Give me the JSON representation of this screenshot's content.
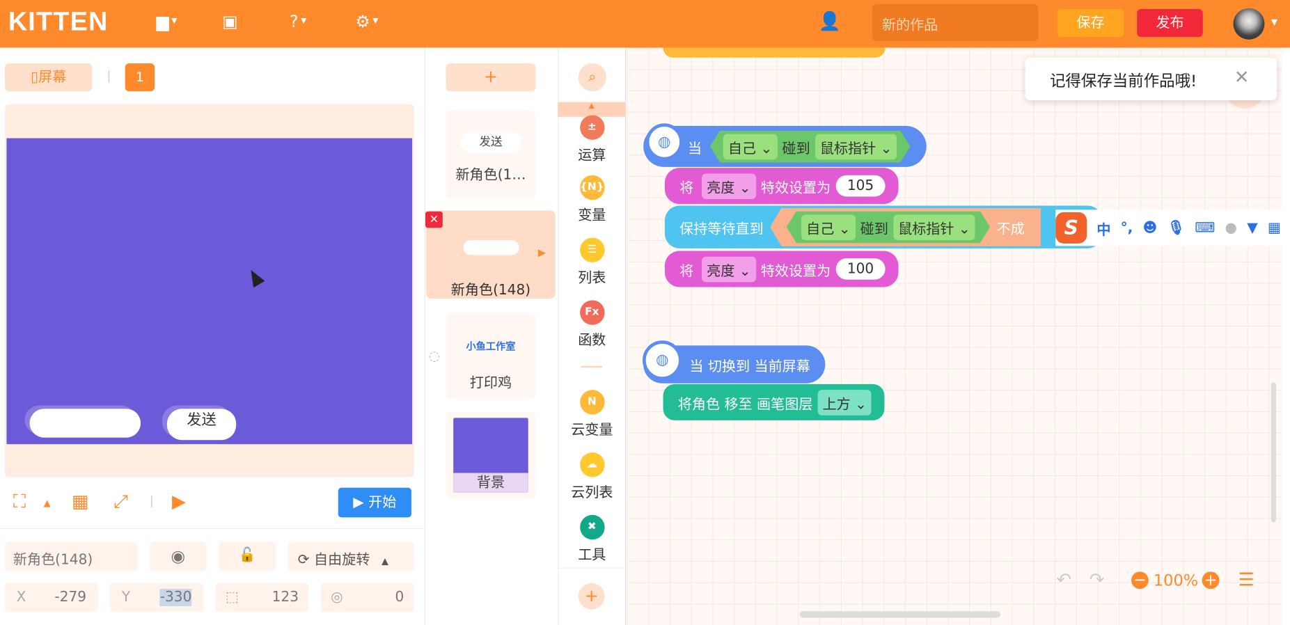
{
  "header": {
    "logo": "KITTEN",
    "project_placeholder": "新的作品",
    "save_label": "保存",
    "publish_label": "发布",
    "colors": {
      "bar": "#ff8a2b",
      "save": "#ffa51f",
      "publish": "#f2283a"
    },
    "icons": [
      "folder-icon",
      "backpack-icon",
      "help-icon",
      "settings-icon",
      "add-user-icon"
    ]
  },
  "stage": {
    "screen_label": "屏幕",
    "page_number": "1",
    "send_label": "发送",
    "start_label": "开始",
    "stage_color": "#6c5bd9"
  },
  "props": {
    "sprite_name": "新角色(148)",
    "rotation_label": "自由旋转",
    "x_label": "X",
    "x": "-279",
    "y_label": "Y",
    "y": "-330",
    "size": "123",
    "direction": "0"
  },
  "sprites": {
    "items": [
      {
        "name": "新角色(1…",
        "thumb_text": "发送"
      },
      {
        "name": "新角色(148)"
      },
      {
        "name": "打印鸡",
        "thumb_text": "小鱼工作室"
      },
      {
        "name": "背景"
      }
    ]
  },
  "categories": [
    {
      "label": "运算",
      "icon": "operator-icon",
      "color": "#f07a5a"
    },
    {
      "label": "变量",
      "icon": "variable-icon",
      "glyph": "{N}",
      "color": "#ffb938"
    },
    {
      "label": "列表",
      "icon": "list-icon",
      "color": "#ffc92e"
    },
    {
      "label": "函数",
      "icon": "function-icon",
      "glyph": "Fx",
      "color": "#f26b5a"
    },
    {
      "label": "云变量",
      "icon": "cloud-variable-icon",
      "glyph": "N",
      "color": "#ffb938"
    },
    {
      "label": "云列表",
      "icon": "cloud-list-icon",
      "color": "#ffc92e"
    },
    {
      "label": "工具",
      "icon": "tool-icon",
      "color": "#12a88a"
    }
  ],
  "blocks": {
    "when": "当",
    "self": "自己",
    "touch": "碰到",
    "mouse": "鼠标指针",
    "set": "将",
    "brightness": "亮度",
    "effect_to": "特效设置为",
    "val1": "105",
    "val2": "100",
    "wait_until": "保持等待直到",
    "not_true": "不成",
    "when_switch": "当 切换到 当前屏幕",
    "move_layer": "将角色 移至 画笔图层",
    "up": "上方"
  },
  "toast": {
    "text": "记得保存当前作品哦!"
  },
  "ime": {
    "chinese": "中",
    "punct": "°,"
  },
  "zoom": {
    "level": "100%"
  }
}
